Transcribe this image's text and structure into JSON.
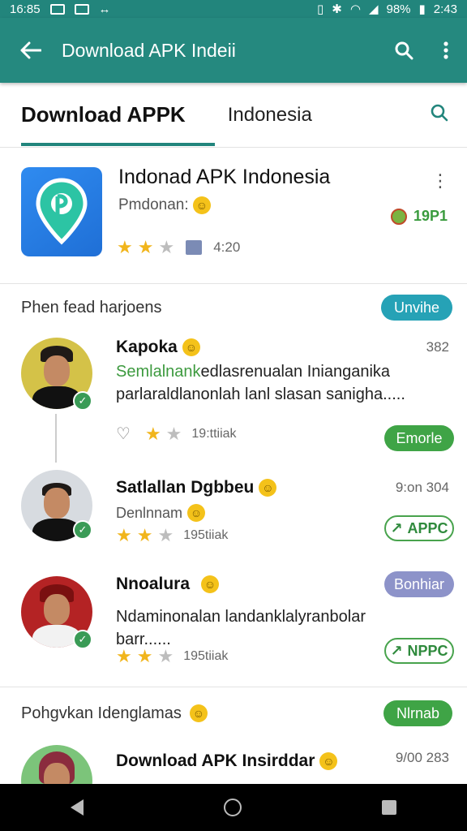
{
  "status": {
    "time": "16:85",
    "battery": "98%",
    "clock_right": "2:43"
  },
  "appbar": {
    "title": "Download APK Indeii"
  },
  "tabs": [
    {
      "label": "Download APPK"
    },
    {
      "label": "Indonesia"
    }
  ],
  "app": {
    "name": "Indonad APK Indonesia",
    "subtitle": "Pmdonan:",
    "rating_count": "4:20",
    "badge": "19P1"
  },
  "section1": {
    "label": "Phen fead harjoens",
    "button": "Unvihe"
  },
  "reviews": [
    {
      "name": "Kapoka",
      "meta": "382",
      "text_highlight": "Semlalnank",
      "text": "edlasrenualan Inianganika parlaraldlanonlah lanl slasan sanigha.....",
      "count": "19:ttiiak",
      "action": "Emorle"
    },
    {
      "name": "Satlallan Dgbbeu",
      "meta": "9:on 304",
      "subtitle": "Denlnnam",
      "count": "195tiiak",
      "action": "APPC"
    },
    {
      "name": "Nnoalura",
      "text": "Ndaminonalan landanklalyranbolar barr......",
      "count": "195tiiak",
      "action_top": "Bonhiar",
      "action": "NPPC"
    }
  ],
  "section2": {
    "label": "Pohgvkan Idenglamas",
    "button": "Nlrnab"
  },
  "review4": {
    "name": "Download APK Insirddar",
    "meta": "9/00 283"
  },
  "colors": {
    "teal": "#25897f",
    "star": "#f1b51c",
    "green": "#3fa446"
  }
}
